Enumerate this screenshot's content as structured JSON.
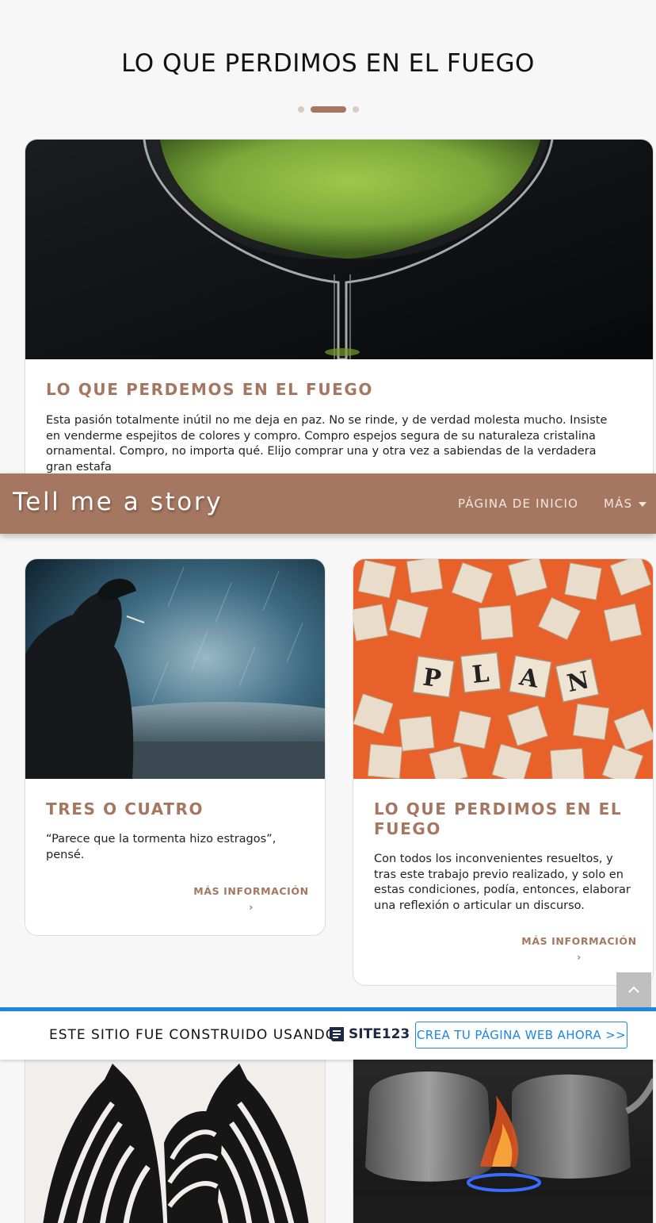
{
  "section": {
    "title": "LO QUE PERDIMOS EN EL FUEGO"
  },
  "cards": [
    {
      "title": "LO QUE PERDEMOS EN EL FUEGO",
      "text": "Esta pasión totalmente inútil no me deja en paz. No se rinde, y de verdad molesta mucho. Insiste en venderme espejitos de colores y compro. Compro espejos segura de su naturaleza cristalina ornamental. Compro, no importa qué. Elijo comprar una y otra vez a sabiendas de la verdadera gran estafa"
    },
    {
      "title": "TRES O CUATRO",
      "text": "“Parece que la tormenta hizo estragos”, pensé.",
      "more": "MÁS INFORMACIÓN"
    },
    {
      "title": "LO QUE PERDIMOS EN EL FUEGO",
      "text": "Con todos los inconvenientes resueltos, y tras este trabajo previo realizado, y solo en estas condiciones, podía, entonces, elaborar una reflexión o articular un discurso.",
      "more": "MÁS INFORMACIÓN"
    }
  ],
  "navbar": {
    "brand": "Tell me a story",
    "home": "PÁGINA DE INICIO",
    "more": "MÁS"
  },
  "banner": {
    "text": "ESTE SITIO FUE CONSTRUIDO USANDO",
    "logo": "SITE123",
    "cta": "CREA TU PÁGINA WEB AHORA >>"
  },
  "carousel": {
    "active_index": 1,
    "count": 3
  },
  "colors": {
    "accent": "#a57761",
    "banner_blue": "#1b86e3",
    "background": "#f8f7f7"
  }
}
